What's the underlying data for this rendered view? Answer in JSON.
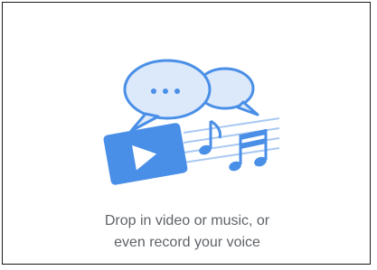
{
  "empty_state": {
    "caption_line1": "Drop in video or music, or",
    "caption_line2": "even record your voice"
  },
  "icons": {
    "chat": "chat-bubbles-icon",
    "video": "video-play-icon",
    "music": "music-notes-icon"
  },
  "colors": {
    "bubble_fill": "#dbe9fb",
    "accent_blue": "#4a8fe7",
    "staff_lines": "#a9c9f2",
    "text": "#5f6368",
    "border": "#1a1a1a"
  }
}
